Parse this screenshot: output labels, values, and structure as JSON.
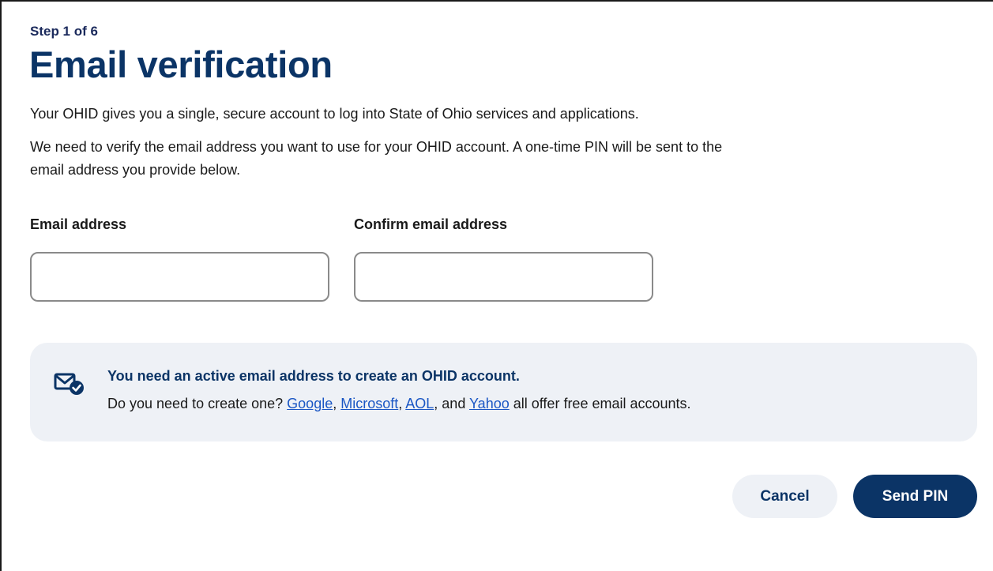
{
  "header": {
    "step": "Step 1 of 6",
    "title": "Email verification"
  },
  "intro": {
    "paragraph1": "Your OHID gives you a single, secure account to log into State of Ohio services and applications.",
    "paragraph2": "We need to verify the email address you want to use for your OHID account. A one-time PIN will be sent to the email address you provide below."
  },
  "form": {
    "email_label": "Email address",
    "email_value": "",
    "confirm_label": "Confirm email address",
    "confirm_value": ""
  },
  "notice": {
    "icon": "mail-check-icon",
    "title": "You need an active email address to create an OHID account.",
    "prefix": "Do you need to create one? ",
    "links": {
      "google": "Google",
      "microsoft": "Microsoft",
      "aol": "AOL",
      "yahoo": "Yahoo"
    },
    "sep1": ", ",
    "sep2": ", ",
    "sep3": ", and ",
    "suffix": " all offer free email accounts."
  },
  "actions": {
    "cancel_label": "Cancel",
    "send_label": "Send PIN"
  },
  "colors": {
    "brand_navy": "#0b3466",
    "panel_bg": "#eef1f6",
    "link": "#1a56c4"
  }
}
